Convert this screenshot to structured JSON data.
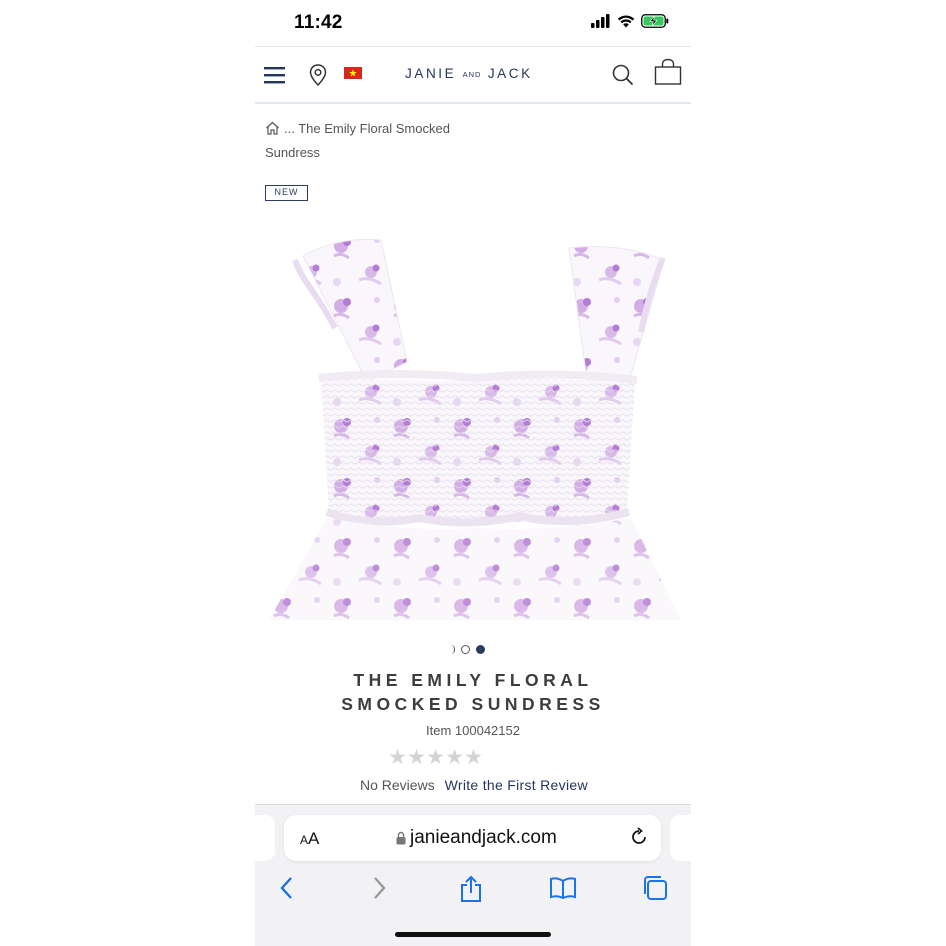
{
  "status_bar": {
    "time": "11:42"
  },
  "header": {
    "logo_part1": "JANIE",
    "logo_and": "AND",
    "logo_part2": "JACK",
    "icons": [
      "menu-icon",
      "location-pin-icon",
      "vietnam-flag-icon",
      "search-icon",
      "shopping-bag-icon"
    ]
  },
  "breadcrumb": {
    "ellipsis": "...",
    "current": "The Emily Floral Smocked Sundress"
  },
  "badge": "NEW",
  "product": {
    "title": "THE EMILY FLORAL SMOCKED SUNDRESS",
    "item_number": "Item 100042152",
    "rating": 0,
    "stars_total": 5,
    "no_reviews_label": "No Reviews",
    "write_review_label": "Write the First Review"
  },
  "carousel": {
    "total_dots": 2,
    "active_index": 1
  },
  "browser": {
    "aa_label_small": "A",
    "aa_label_big": "A",
    "url": "janieandjack.com"
  },
  "colors": {
    "brand_navy": "#23355e",
    "dress_purple": "#b57bd6",
    "star_empty": "#d4d4d4"
  }
}
